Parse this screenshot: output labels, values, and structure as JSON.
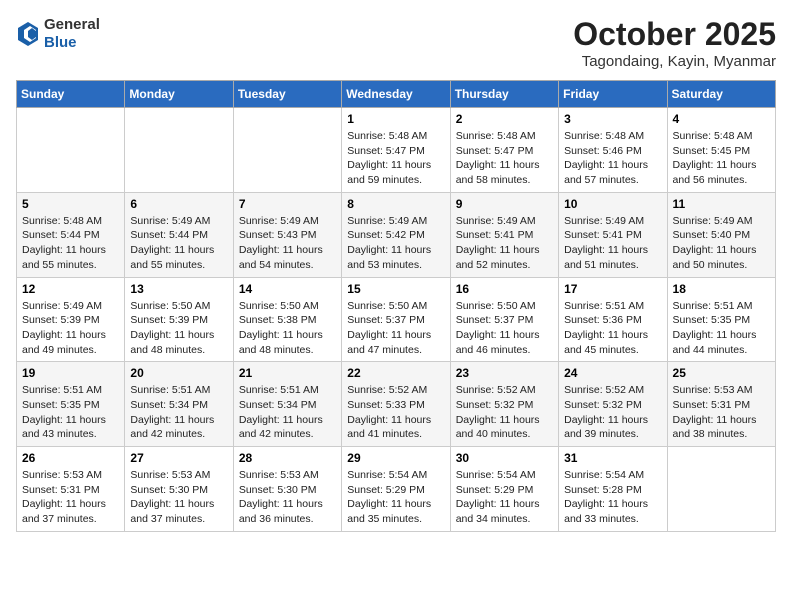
{
  "header": {
    "logo_line1": "General",
    "logo_line2": "Blue",
    "month_title": "October 2025",
    "subtitle": "Tagondaing, Kayin, Myanmar"
  },
  "days_of_week": [
    "Sunday",
    "Monday",
    "Tuesday",
    "Wednesday",
    "Thursday",
    "Friday",
    "Saturday"
  ],
  "weeks": [
    [
      {
        "day": "",
        "info": ""
      },
      {
        "day": "",
        "info": ""
      },
      {
        "day": "",
        "info": ""
      },
      {
        "day": "1",
        "info": "Sunrise: 5:48 AM\nSunset: 5:47 PM\nDaylight: 11 hours\nand 59 minutes."
      },
      {
        "day": "2",
        "info": "Sunrise: 5:48 AM\nSunset: 5:47 PM\nDaylight: 11 hours\nand 58 minutes."
      },
      {
        "day": "3",
        "info": "Sunrise: 5:48 AM\nSunset: 5:46 PM\nDaylight: 11 hours\nand 57 minutes."
      },
      {
        "day": "4",
        "info": "Sunrise: 5:48 AM\nSunset: 5:45 PM\nDaylight: 11 hours\nand 56 minutes."
      }
    ],
    [
      {
        "day": "5",
        "info": "Sunrise: 5:48 AM\nSunset: 5:44 PM\nDaylight: 11 hours\nand 55 minutes."
      },
      {
        "day": "6",
        "info": "Sunrise: 5:49 AM\nSunset: 5:44 PM\nDaylight: 11 hours\nand 55 minutes."
      },
      {
        "day": "7",
        "info": "Sunrise: 5:49 AM\nSunset: 5:43 PM\nDaylight: 11 hours\nand 54 minutes."
      },
      {
        "day": "8",
        "info": "Sunrise: 5:49 AM\nSunset: 5:42 PM\nDaylight: 11 hours\nand 53 minutes."
      },
      {
        "day": "9",
        "info": "Sunrise: 5:49 AM\nSunset: 5:41 PM\nDaylight: 11 hours\nand 52 minutes."
      },
      {
        "day": "10",
        "info": "Sunrise: 5:49 AM\nSunset: 5:41 PM\nDaylight: 11 hours\nand 51 minutes."
      },
      {
        "day": "11",
        "info": "Sunrise: 5:49 AM\nSunset: 5:40 PM\nDaylight: 11 hours\nand 50 minutes."
      }
    ],
    [
      {
        "day": "12",
        "info": "Sunrise: 5:49 AM\nSunset: 5:39 PM\nDaylight: 11 hours\nand 49 minutes."
      },
      {
        "day": "13",
        "info": "Sunrise: 5:50 AM\nSunset: 5:39 PM\nDaylight: 11 hours\nand 48 minutes."
      },
      {
        "day": "14",
        "info": "Sunrise: 5:50 AM\nSunset: 5:38 PM\nDaylight: 11 hours\nand 48 minutes."
      },
      {
        "day": "15",
        "info": "Sunrise: 5:50 AM\nSunset: 5:37 PM\nDaylight: 11 hours\nand 47 minutes."
      },
      {
        "day": "16",
        "info": "Sunrise: 5:50 AM\nSunset: 5:37 PM\nDaylight: 11 hours\nand 46 minutes."
      },
      {
        "day": "17",
        "info": "Sunrise: 5:51 AM\nSunset: 5:36 PM\nDaylight: 11 hours\nand 45 minutes."
      },
      {
        "day": "18",
        "info": "Sunrise: 5:51 AM\nSunset: 5:35 PM\nDaylight: 11 hours\nand 44 minutes."
      }
    ],
    [
      {
        "day": "19",
        "info": "Sunrise: 5:51 AM\nSunset: 5:35 PM\nDaylight: 11 hours\nand 43 minutes."
      },
      {
        "day": "20",
        "info": "Sunrise: 5:51 AM\nSunset: 5:34 PM\nDaylight: 11 hours\nand 42 minutes."
      },
      {
        "day": "21",
        "info": "Sunrise: 5:51 AM\nSunset: 5:34 PM\nDaylight: 11 hours\nand 42 minutes."
      },
      {
        "day": "22",
        "info": "Sunrise: 5:52 AM\nSunset: 5:33 PM\nDaylight: 11 hours\nand 41 minutes."
      },
      {
        "day": "23",
        "info": "Sunrise: 5:52 AM\nSunset: 5:32 PM\nDaylight: 11 hours\nand 40 minutes."
      },
      {
        "day": "24",
        "info": "Sunrise: 5:52 AM\nSunset: 5:32 PM\nDaylight: 11 hours\nand 39 minutes."
      },
      {
        "day": "25",
        "info": "Sunrise: 5:53 AM\nSunset: 5:31 PM\nDaylight: 11 hours\nand 38 minutes."
      }
    ],
    [
      {
        "day": "26",
        "info": "Sunrise: 5:53 AM\nSunset: 5:31 PM\nDaylight: 11 hours\nand 37 minutes."
      },
      {
        "day": "27",
        "info": "Sunrise: 5:53 AM\nSunset: 5:30 PM\nDaylight: 11 hours\nand 37 minutes."
      },
      {
        "day": "28",
        "info": "Sunrise: 5:53 AM\nSunset: 5:30 PM\nDaylight: 11 hours\nand 36 minutes."
      },
      {
        "day": "29",
        "info": "Sunrise: 5:54 AM\nSunset: 5:29 PM\nDaylight: 11 hours\nand 35 minutes."
      },
      {
        "day": "30",
        "info": "Sunrise: 5:54 AM\nSunset: 5:29 PM\nDaylight: 11 hours\nand 34 minutes."
      },
      {
        "day": "31",
        "info": "Sunrise: 5:54 AM\nSunset: 5:28 PM\nDaylight: 11 hours\nand 33 minutes."
      },
      {
        "day": "",
        "info": ""
      }
    ]
  ]
}
